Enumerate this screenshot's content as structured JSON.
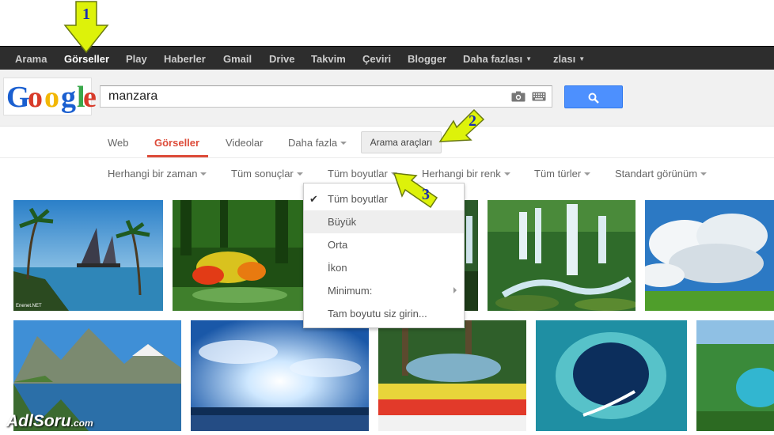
{
  "topbar": {
    "items": [
      "Arama",
      "Görseller",
      "Play",
      "Haberler",
      "Gmail",
      "Drive",
      "Takvim",
      "Çeviri",
      "Blogger",
      "Daha fazlası",
      "zlası"
    ]
  },
  "logo": {
    "text": "Google"
  },
  "search": {
    "value": "manzara"
  },
  "tabs": [
    "Web",
    "Görseller",
    "Videolar",
    "Daha fazla"
  ],
  "tools_button": "Arama araçları",
  "filters": [
    "Herhangi bir zaman",
    "Tüm sonuçlar",
    "Tüm boyutlar",
    "Herhangi bir renk",
    "Tüm türler",
    "Standart görünüm"
  ],
  "size_menu": {
    "items": [
      "Tüm boyutlar",
      "Büyük",
      "Orta",
      "İkon",
      "Minimum:",
      "Tam boyutu siz girin..."
    ],
    "checked": "Tüm boyutlar",
    "highlighted": "Büyük"
  },
  "annotations": [
    "1",
    "2",
    "3"
  ],
  "thumb_caption": "Enenet.NET",
  "watermark": {
    "main": "AdlSoru",
    "suffix": ".com"
  },
  "colors": {
    "accent_red": "#dd4b39",
    "search_blue": "#4d90fe",
    "topbar": "#2d2d2d",
    "arrow_yellow": "#ddf20a"
  }
}
